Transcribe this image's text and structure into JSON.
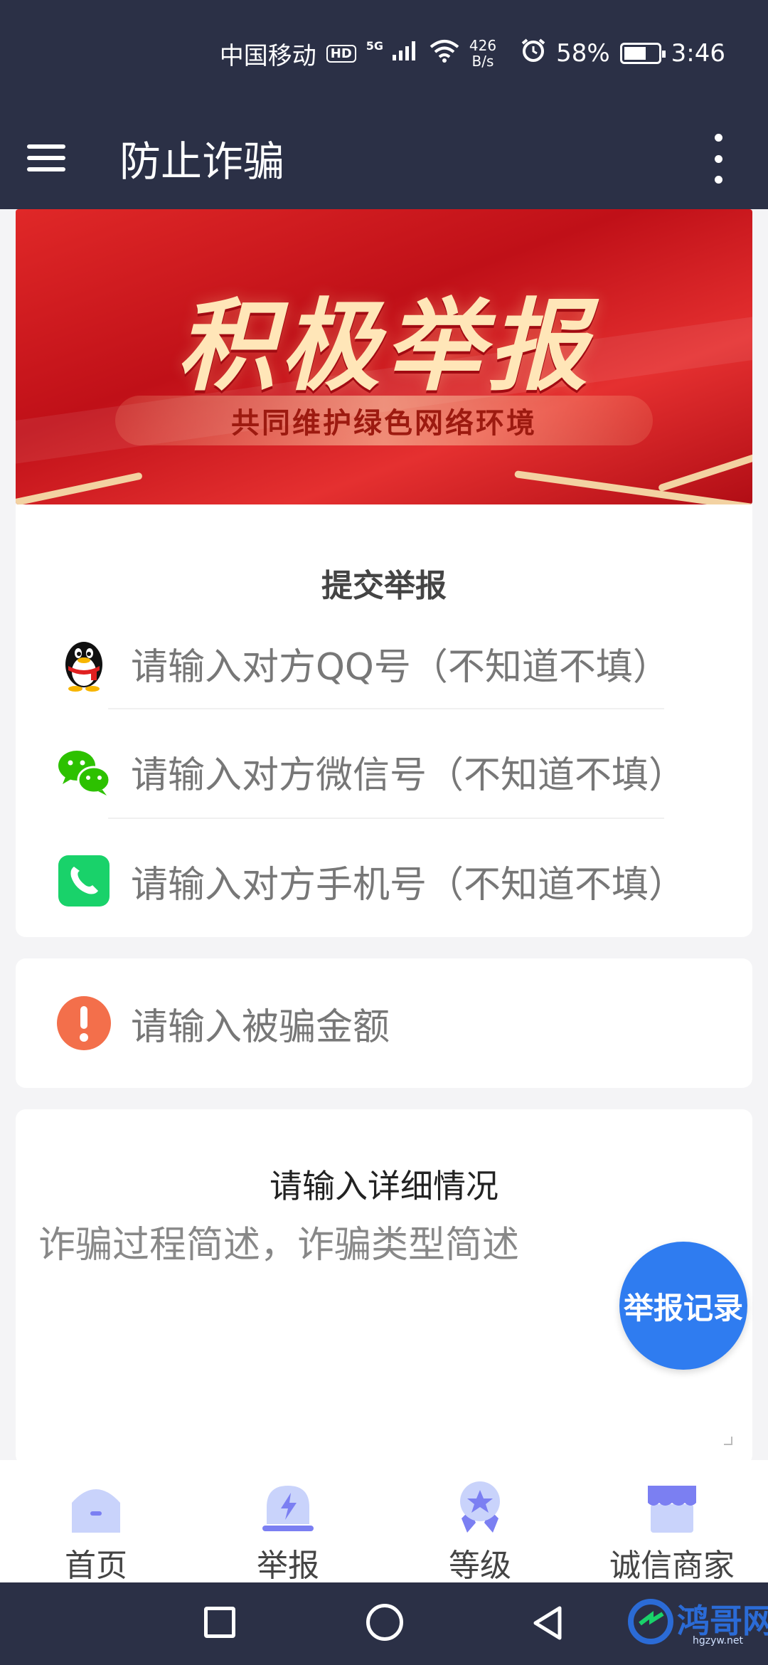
{
  "status_bar": {
    "carrier": "中国移动",
    "hd": "HD",
    "signal_type": "5G",
    "net_speed_value": "426",
    "net_speed_unit": "B/s",
    "battery": "58%",
    "time": "3:46"
  },
  "app_bar": {
    "title": "防止诈骗",
    "menu_icon": "hamburger-menu-icon",
    "more_icon": "more-vert-icon"
  },
  "banner": {
    "title": "积极举报",
    "subtitle": "共同维护绿色网络环境"
  },
  "report_card": {
    "title": "提交举报",
    "fields": [
      {
        "icon": "qq-penguin-icon",
        "placeholder": "请输入对方QQ号（不知道不填）"
      },
      {
        "icon": "wechat-icon",
        "placeholder": "请输入对方微信号（不知道不填）"
      },
      {
        "icon": "phone-icon",
        "placeholder": "请输入对方手机号（不知道不填）"
      }
    ]
  },
  "amount_card": {
    "icon": "warning-icon",
    "placeholder": "请输入被骗金额"
  },
  "detail_card": {
    "title": "请输入详细情况",
    "placeholder": "诈骗过程简述，诈骗类型简述"
  },
  "fab": {
    "label": "举报记录"
  },
  "tab_bar": {
    "tabs": [
      {
        "label": "首页",
        "icon": "home-icon"
      },
      {
        "label": "举报",
        "icon": "alarm-icon"
      },
      {
        "label": "等级",
        "icon": "medal-icon"
      },
      {
        "label": "诚信商家",
        "icon": "store-icon"
      }
    ]
  },
  "watermark": {
    "name": "鸿哥网",
    "url": "hgzyw.net"
  },
  "colors": {
    "header": "#2b3046",
    "accent": "#2f7cf0",
    "tab_icon": "#7b7ff2",
    "warning": "#f36f4b",
    "phone_green": "#19d26a",
    "wechat_green": "#2dc100"
  }
}
